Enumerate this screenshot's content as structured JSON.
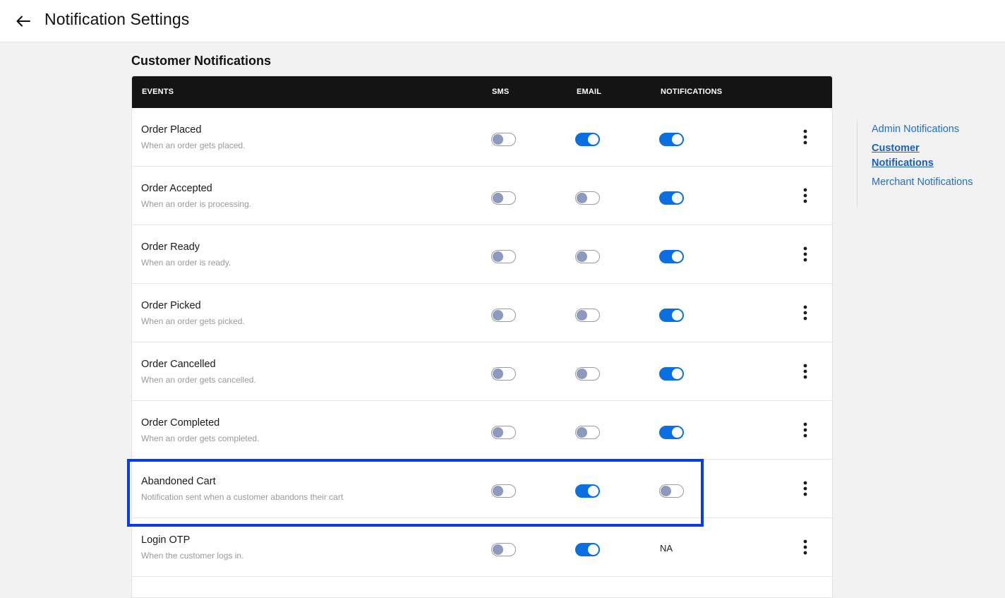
{
  "header": {
    "title": "Notification Settings"
  },
  "section": {
    "title": "Customer Notifications"
  },
  "table": {
    "columns": [
      "EVENTS",
      "SMS",
      "EMAIL",
      "NOTIFICATIONS"
    ],
    "rows": [
      {
        "title": "Order Placed",
        "description": "When an order gets placed.",
        "sms": "off",
        "email": "on",
        "notifications": "on",
        "notifications_text": ""
      },
      {
        "title": "Order Accepted",
        "description": "When an order is processing.",
        "sms": "off",
        "email": "off",
        "notifications": "on",
        "notifications_text": ""
      },
      {
        "title": "Order Ready",
        "description": "When an order is ready.",
        "sms": "off",
        "email": "off",
        "notifications": "on",
        "notifications_text": ""
      },
      {
        "title": "Order Picked",
        "description": "When an order gets picked.",
        "sms": "off",
        "email": "off",
        "notifications": "on",
        "notifications_text": ""
      },
      {
        "title": "Order Cancelled",
        "description": "When an order gets cancelled.",
        "sms": "off",
        "email": "off",
        "notifications": "on",
        "notifications_text": ""
      },
      {
        "title": "Order Completed",
        "description": "When an order gets completed.",
        "sms": "off",
        "email": "off",
        "notifications": "on",
        "notifications_text": ""
      },
      {
        "title": "Abandoned Cart",
        "description": "Notification sent when a customer abandons their cart",
        "sms": "off",
        "email": "on",
        "notifications": "off",
        "notifications_text": ""
      },
      {
        "title": "Login OTP",
        "description": "When the customer logs in.",
        "sms": "off",
        "email": "on",
        "notifications": "na",
        "notifications_text": "NA"
      }
    ]
  },
  "sidenav": {
    "items": [
      {
        "label": "Admin Notifications",
        "active": false
      },
      {
        "label": "Customer Notifications",
        "active": true
      },
      {
        "label": "Merchant Notifications",
        "active": false
      }
    ]
  },
  "colors": {
    "toggle_on": "#0a6fe0",
    "toggle_off_knob": "#8c9bbd",
    "header_bg": "#141414",
    "highlight": "#0a3de6",
    "link": "#1f6fd1"
  }
}
